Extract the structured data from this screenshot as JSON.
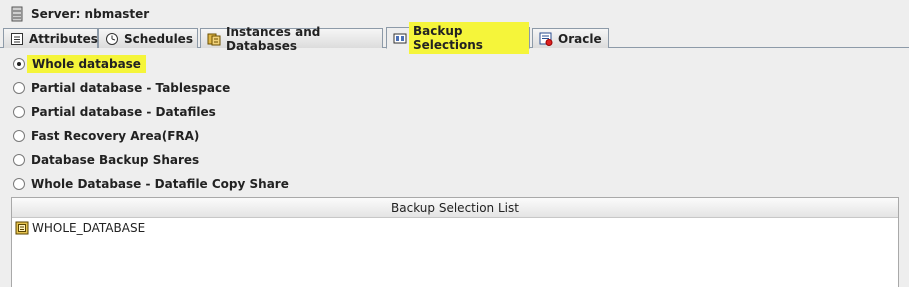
{
  "server": {
    "label": "Server: nbmaster",
    "icon": "server-icon"
  },
  "tabs": [
    {
      "label": "Attributes",
      "icon": "attributes-icon",
      "active": false
    },
    {
      "label": "Schedules",
      "icon": "schedules-icon",
      "active": false
    },
    {
      "label": "Instances and Databases",
      "icon": "instances-icon",
      "active": false
    },
    {
      "label": "Backup Selections",
      "icon": "backup-selections-icon",
      "active": true
    },
    {
      "label": "Oracle",
      "icon": "oracle-icon",
      "active": false
    }
  ],
  "options": [
    {
      "label": "Whole database",
      "selected": true
    },
    {
      "label": "Partial database - Tablespace",
      "selected": false
    },
    {
      "label": "Partial database - Datafiles",
      "selected": false
    },
    {
      "label": "Fast Recovery Area(FRA)",
      "selected": false
    },
    {
      "label": "Database Backup Shares",
      "selected": false
    },
    {
      "label": "Whole Database - Datafile Copy Share",
      "selected": false
    }
  ],
  "selection_list": {
    "header": "Backup Selection List",
    "items": [
      {
        "label": "WHOLE_DATABASE",
        "icon": "database-icon"
      }
    ]
  },
  "colors": {
    "highlight": "#f5f53a",
    "tab_border": "#8d9aa8",
    "background": "#eeeeee"
  }
}
